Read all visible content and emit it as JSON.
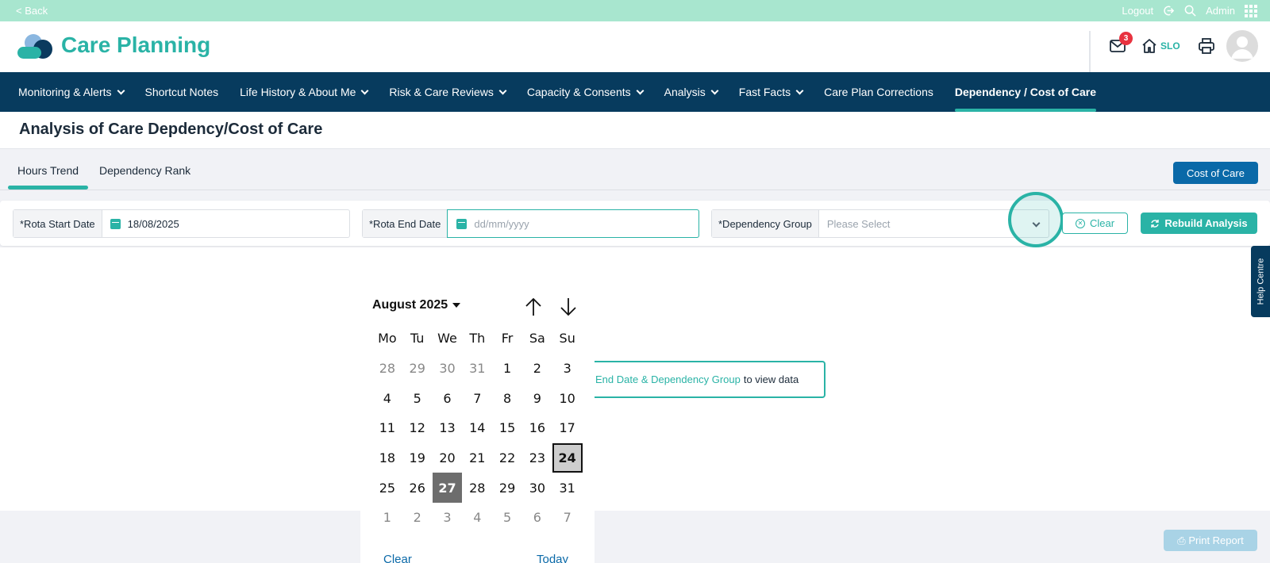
{
  "topbar": {
    "back": "< Back",
    "logout": "Logout",
    "admin": "Admin"
  },
  "header": {
    "brand": "Care Planning",
    "mail_count": "3",
    "home_label": "SLO"
  },
  "nav": {
    "items": [
      {
        "label": "Monitoring & Alerts",
        "dropdown": true
      },
      {
        "label": "Shortcut Notes",
        "dropdown": false
      },
      {
        "label": "Life History & About Me",
        "dropdown": true
      },
      {
        "label": "Risk & Care Reviews",
        "dropdown": true
      },
      {
        "label": "Capacity & Consents",
        "dropdown": true
      },
      {
        "label": "Analysis",
        "dropdown": true
      },
      {
        "label": "Fast Facts",
        "dropdown": true
      },
      {
        "label": "Care Plan Corrections",
        "dropdown": false
      },
      {
        "label": "Dependency / Cost of Care",
        "dropdown": false,
        "active": true
      }
    ]
  },
  "page": {
    "title": "Analysis of Care Depdency/Cost of Care"
  },
  "tabs": {
    "hours_trend": "Hours Trend",
    "dependency_rank": "Dependency Rank",
    "cost_of_care": "Cost of Care"
  },
  "filters": {
    "start_label": "*Rota Start Date",
    "start_value": "18/08/2025",
    "end_label": "*Rota End Date",
    "end_placeholder": "dd/mm/yyyy",
    "group_label": "*Dependency Group",
    "group_placeholder": "Please Select",
    "clear": "Clear",
    "rebuild": "Rebuild Analysis"
  },
  "info": {
    "highlight": "End Date & Dependency Group",
    "rest": "to view data"
  },
  "help_centre": "Help Centre",
  "print_report": "Print Report",
  "calendar": {
    "month": "August 2025",
    "weekdays": [
      "Mo",
      "Tu",
      "We",
      "Th",
      "Fr",
      "Sa",
      "Su"
    ],
    "weeks": [
      [
        "28",
        "29",
        "30",
        "31",
        "1",
        "2",
        "3"
      ],
      [
        "4",
        "5",
        "6",
        "7",
        "8",
        "9",
        "10"
      ],
      [
        "11",
        "12",
        "13",
        "14",
        "15",
        "16",
        "17"
      ],
      [
        "18",
        "19",
        "20",
        "21",
        "22",
        "23",
        "24"
      ],
      [
        "25",
        "26",
        "27",
        "28",
        "29",
        "30",
        "31"
      ],
      [
        "1",
        "2",
        "3",
        "4",
        "5",
        "6",
        "7"
      ]
    ],
    "selected_day": "24",
    "today_day": "27",
    "clear": "Clear",
    "today": "Today"
  },
  "colors": {
    "accent": "#2ab3a6",
    "nav_bg": "#073b5e",
    "topbar_bg": "#a8e6cf",
    "badge": "#e8323f",
    "primary_button": "#0a69a8"
  }
}
